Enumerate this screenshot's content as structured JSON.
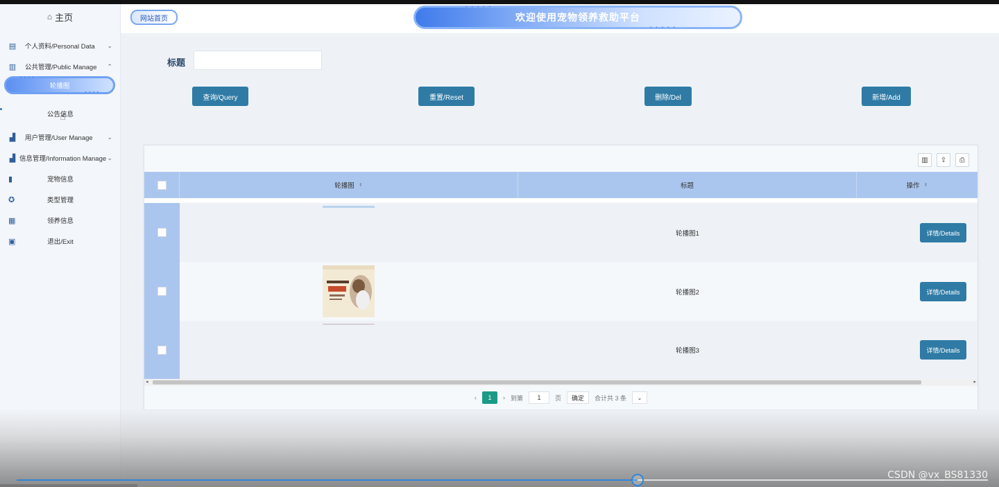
{
  "sidebar": {
    "home": "主页",
    "personal": "个人资料/Personal Data",
    "public": "公共管理/Public Manage",
    "carousel": "轮播图",
    "notice": "公告信息",
    "user": "用户管理/User Manage",
    "info": "信息管理/Information Manage",
    "pet_info": "宠物信息",
    "type_manage": "类型管理",
    "adopt_info": "领养信息",
    "exit": "退出/Exit"
  },
  "header": {
    "home_button": "网站首页",
    "banner_title": "欢迎使用宠物领养救助平台"
  },
  "search": {
    "label": "标题",
    "value": ""
  },
  "buttons": {
    "query": "查询/Query",
    "reset": "重置/Reset",
    "delete": "删除/Del",
    "add": "新增/Add"
  },
  "table": {
    "columns": [
      "轮播图",
      "标题",
      "操作"
    ],
    "rows": [
      {
        "title": "轮播图1",
        "action": "详情/Details"
      },
      {
        "title": "轮播图2",
        "action": "详情/Details"
      },
      {
        "title": "轮播图3",
        "action": "详情/Details"
      }
    ]
  },
  "pager": {
    "current": "1",
    "goto_label": "到第",
    "goto_value": "1",
    "page_unit": "页",
    "confirm": "确定",
    "total": "合计共 3 条"
  },
  "watermark": "CSDN @vx_BS81330",
  "colors": {
    "primary_button": "#2f7ba5",
    "table_header": "#abc6ee",
    "pager_active": "#1a9a87"
  }
}
